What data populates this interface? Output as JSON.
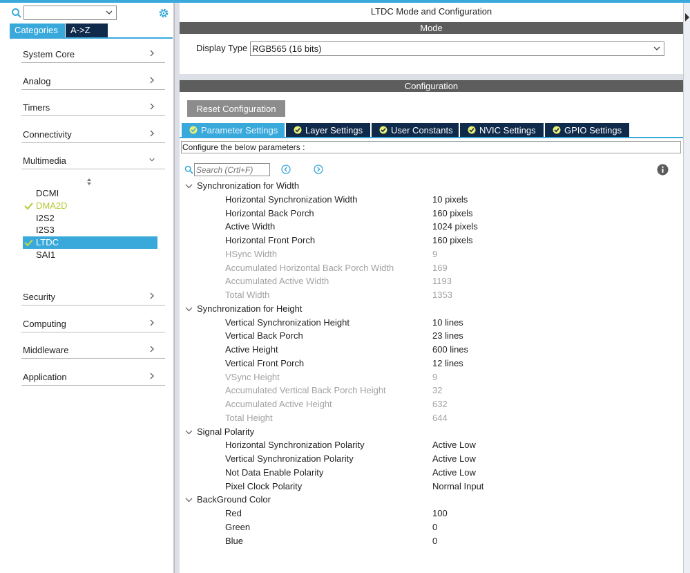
{
  "colors": {
    "accent": "#39a9dc",
    "dark_navy": "#0f2a4a",
    "header_gray": "#5d5d5d",
    "enabled_green": "#b5c832",
    "readonly_gray": "#a2a2a2"
  },
  "sidebar": {
    "search": {
      "value": ""
    },
    "tabs": [
      {
        "label": "Categories"
      },
      {
        "label": "A->Z"
      }
    ],
    "categories": [
      {
        "label": "System Core"
      },
      {
        "label": "Analog"
      },
      {
        "label": "Timers"
      },
      {
        "label": "Connectivity"
      },
      {
        "label": "Multimedia"
      },
      {
        "label": "Security"
      },
      {
        "label": "Computing"
      },
      {
        "label": "Middleware"
      },
      {
        "label": "Application"
      }
    ],
    "multimedia_items": [
      {
        "label": "DCMI"
      },
      {
        "label": "DMA2D"
      },
      {
        "label": "I2S2"
      },
      {
        "label": "I2S3"
      },
      {
        "label": "LTDC"
      },
      {
        "label": "SAI1"
      }
    ]
  },
  "main": {
    "title": "LTDC Mode and Configuration",
    "mode_header": "Mode",
    "display_type_label": "Display Type",
    "display_type_value": "RGB565 (16 bits)",
    "config_header": "Configuration",
    "reset_label": "Reset Configuration",
    "tabs": [
      {
        "label": "Parameter Settings"
      },
      {
        "label": "Layer Settings"
      },
      {
        "label": "User Constants"
      },
      {
        "label": "NVIC Settings"
      },
      {
        "label": "GPIO Settings"
      }
    ],
    "hint": "Configure the below parameters :",
    "search_placeholder": "Search (Crtl+F)",
    "groups": [
      {
        "title": "Synchronization for Width",
        "params": [
          {
            "name": "Horizontal Synchronization Width",
            "value": "10 pixels"
          },
          {
            "name": "Horizontal Back Porch",
            "value": "160 pixels"
          },
          {
            "name": "Active Width",
            "value": "1024 pixels"
          },
          {
            "name": "Horizontal Front Porch",
            "value": "160 pixels"
          },
          {
            "name": "HSync Width",
            "value": "9"
          },
          {
            "name": "Accumulated Horizontal Back Porch Width",
            "value": "169"
          },
          {
            "name": "Accumulated Active Width",
            "value": "1193"
          },
          {
            "name": "Total Width",
            "value": "1353"
          }
        ]
      },
      {
        "title": "Synchronization for Height",
        "params": [
          {
            "name": "Vertical Synchronization Height",
            "value": "10 lines"
          },
          {
            "name": "Vertical Back Porch",
            "value": "23 lines"
          },
          {
            "name": "Active Height",
            "value": "600 lines"
          },
          {
            "name": "Vertical Front Porch",
            "value": "12 lines"
          },
          {
            "name": "VSync Height",
            "value": "9"
          },
          {
            "name": "Accumulated Vertical Back Porch Height",
            "value": "32"
          },
          {
            "name": "Accumulated Active Height",
            "value": "632"
          },
          {
            "name": "Total Height",
            "value": "644"
          }
        ]
      },
      {
        "title": "Signal Polarity",
        "params": [
          {
            "name": "Horizontal Synchronization Polarity",
            "value": "Active Low"
          },
          {
            "name": "Vertical Synchronization Polarity",
            "value": "Active Low"
          },
          {
            "name": "Not Data Enable Polarity",
            "value": "Active Low"
          },
          {
            "name": "Pixel Clock Polarity",
            "value": "Normal Input"
          }
        ]
      },
      {
        "title": "BackGround Color",
        "params": [
          {
            "name": "Red",
            "value": "100"
          },
          {
            "name": "Green",
            "value": "0"
          },
          {
            "name": "Blue",
            "value": "0"
          }
        ]
      }
    ]
  }
}
